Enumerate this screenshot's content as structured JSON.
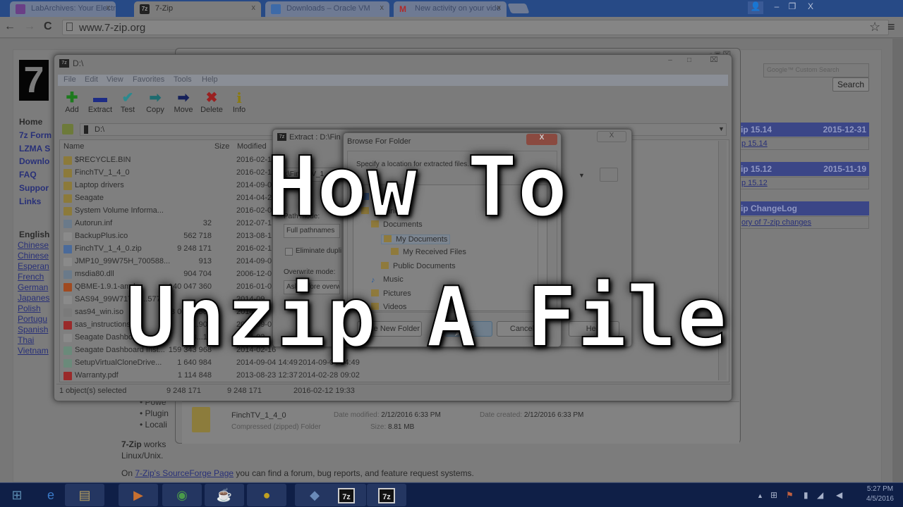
{
  "overlay_title": {
    "line1": "How To",
    "line2": "Unzip A File"
  },
  "browser": {
    "tabs": [
      {
        "label": "LabArchives: Your Electro",
        "icon": "flask-icon",
        "active": false
      },
      {
        "label": "7-Zip",
        "icon": "7zip-icon",
        "active": true
      },
      {
        "label": "Downloads – Oracle VM",
        "icon": "virtualbox-icon",
        "active": false
      },
      {
        "label": "New activity on your vide",
        "icon": "gmail-icon",
        "active": false
      }
    ],
    "url": "www.7-zip.org",
    "nav": {
      "back": "←",
      "forward": "→",
      "reload": "C"
    },
    "star": "☆",
    "menu": "≡",
    "window_controls": {
      "user": "👤",
      "minimize": "–",
      "maximize": "❐",
      "close": "X"
    }
  },
  "website": {
    "logo": "7",
    "nav": [
      "Home",
      "7z Form",
      "LZMA S",
      "Downlo",
      "FAQ",
      "Suppor",
      "Links"
    ],
    "languages_heading": "English",
    "languages": [
      "Chinese",
      "Chinese",
      "Esperan",
      "French",
      "German",
      "Japanes",
      "Polish",
      "Portugu",
      "Spanish",
      "Thai",
      "Vietnam"
    ],
    "search_placeholder": "Google™ Custom Search",
    "search_button": "Search",
    "releases": [
      {
        "title": "zip 15.14",
        "date": "2015-12-31",
        "link": "p 15.14"
      },
      {
        "title": "zip 15.12",
        "date": "2015-11-19",
        "link": "p 15.12"
      },
      {
        "title": "zip ChangeLog",
        "date": "",
        "link": "ory of 7-zip changes"
      }
    ],
    "bullets": [
      "Powe",
      "Plugin",
      "Locali"
    ],
    "works_bold": "7-Zip",
    "works_text": "works",
    "works_line2": "Linux/Unix.",
    "sf_prefix": "On ",
    "sf_link": "7-Zip's SourceForge Page",
    "sf_suffix": " you can find a forum, bug reports, and feature request systems."
  },
  "explorer_details": {
    "name": "FinchTV_1_4_0",
    "type": "Compressed (zipped) Folder",
    "date_modified_label": "Date modified:",
    "date_modified": "2/12/2016 6:33 PM",
    "date_created_label": "Date created:",
    "date_created": "2/12/2016 6:33 PM",
    "size_label": "Size:",
    "size": "8.81 MB"
  },
  "sevenzip": {
    "title": "D:\\",
    "menu": [
      "File",
      "Edit",
      "View",
      "Favorites",
      "Tools",
      "Help"
    ],
    "toolbar": [
      {
        "label": "Add",
        "icon": "plus-icon",
        "glyph": "✚",
        "color": "#1e7a1e"
      },
      {
        "label": "Extract",
        "icon": "minus-icon",
        "glyph": "▬",
        "color": "#1d2c86"
      },
      {
        "label": "Test",
        "icon": "checkmark-icon",
        "glyph": "✔",
        "color": "#2b8a8f"
      },
      {
        "label": "Copy",
        "icon": "copy-arrow-icon",
        "glyph": "➡",
        "color": "#1e6b6f"
      },
      {
        "label": "Move",
        "icon": "move-arrow-icon",
        "glyph": "➡",
        "color": "#15205a"
      },
      {
        "label": "Delete",
        "icon": "delete-x-icon",
        "glyph": "✖",
        "color": "#9a2020"
      },
      {
        "label": "Info",
        "icon": "info-icon",
        "glyph": "i",
        "color": "#8a7a10"
      }
    ],
    "address": "D:\\",
    "columns": {
      "name": "Name",
      "size": "Size",
      "modified": "Modified"
    },
    "files": [
      {
        "name": "$RECYCLE.BIN",
        "size": "",
        "modified": "2016-02-1",
        "extra": "",
        "type": "folder"
      },
      {
        "name": "FinchTV_1_4_0",
        "size": "",
        "modified": "2016-02-1",
        "extra": "",
        "type": "folder"
      },
      {
        "name": "Laptop drivers",
        "size": "",
        "modified": "2014-09-0",
        "extra": "",
        "type": "folder"
      },
      {
        "name": "Seagate",
        "size": "",
        "modified": "2014-04-2",
        "extra": "",
        "type": "folder"
      },
      {
        "name": "System Volume Informa...",
        "size": "",
        "modified": "2016-02-0",
        "extra": "",
        "type": "folder"
      },
      {
        "name": "Autorun.inf",
        "size": "32",
        "modified": "2012-07-1",
        "extra": "",
        "type": "inf"
      },
      {
        "name": "BackupPlus.ico",
        "size": "562 718",
        "modified": "2013-08-1",
        "extra": "",
        "type": "file"
      },
      {
        "name": "FinchTV_1_4_0.zip",
        "size": "9 248 171",
        "modified": "2016-02-1",
        "extra": "",
        "type": "zip"
      },
      {
        "name": "JMP10_99W75H_700588...",
        "size": "913",
        "modified": "2014-09-0",
        "extra": "",
        "type": "file"
      },
      {
        "name": "msdia80.dll",
        "size": "904 704",
        "modified": "2006-12-0",
        "extra": "",
        "type": "dll"
      },
      {
        "name": "QBME-1.9.1-amd...",
        "size": "140 047 360",
        "modified": "2016-01-0",
        "extra": "",
        "type": "box"
      },
      {
        "name": "SAS94_99W71T_7...577...",
        "size": "",
        "modified": "2014-09",
        "extra": "",
        "type": "file"
      },
      {
        "name": "sas94_win.iso",
        "size": "3 003 ...584",
        "modified": "2014-09",
        "extra": "",
        "type": "iso"
      },
      {
        "name": "sas_instructions.p...",
        "size": "1 ...907",
        "modified": "2014-09-0",
        "extra": "",
        "type": "pdf"
      },
      {
        "name": "Seagate Dashboard...",
        "size": "13...15",
        "modified": "2014-02",
        "extra": "",
        "type": "file"
      },
      {
        "name": "Seagate Dashboard Inst...",
        "size": "159 343 968",
        "modified": "2014-02-16",
        "extra": "",
        "type": "exe"
      },
      {
        "name": "SetupVirtualCloneDrive...",
        "size": "1 640 984",
        "modified": "2014-09-04 14:49",
        "extra": "2014-09-04 14:49",
        "type": "exe"
      },
      {
        "name": "Warranty.pdf",
        "size": "1 114 848",
        "modified": "2013-08-23 12:37",
        "extra": "2014-02-28 09:02",
        "type": "pdf"
      }
    ],
    "status": {
      "selected": "1 object(s) selected",
      "size": "9 248 171",
      "packed": "9 248 171",
      "date": "2016-02-12 19:33"
    }
  },
  "extract_dialog": {
    "title": "Extract : D:\\Fin",
    "path_value": "D:\\FinchTV_1_4_",
    "path_mode_label": "Path mode:",
    "path_mode_value": "Full pathnames",
    "eliminate_label": "Eliminate duplicate",
    "overwrite_label": "Overwrite mode:",
    "overwrite_value": "Ask before overwrite",
    "close": "X",
    "help_button": "Help"
  },
  "browse_dialog": {
    "title": "Browse For Folder",
    "close": "X",
    "prompt": "Specify a location for extracted files.",
    "tree": [
      {
        "label": "Desktop",
        "level": 0,
        "icon": "desktop-icon"
      },
      {
        "label": "Libraries",
        "level": 0,
        "icon": "libraries-icon",
        "expanded": true
      },
      {
        "label": "Documents",
        "level": 1,
        "icon": "folder-icon"
      },
      {
        "label": "My Documents",
        "level": 2,
        "icon": "folder-icon",
        "selected": true,
        "expanded": true
      },
      {
        "label": "My Received Files",
        "level": 3,
        "icon": "folder-icon"
      },
      {
        "label": "Public Documents",
        "level": 2,
        "icon": "folder-icon"
      },
      {
        "label": "Music",
        "level": 1,
        "icon": "music-icon"
      },
      {
        "label": "Pictures",
        "level": 1,
        "icon": "folder-icon"
      },
      {
        "label": "Videos",
        "level": 1,
        "icon": "folder-icon"
      }
    ],
    "make_folder_button": "Make New Folder",
    "ok_button": "OK",
    "cancel_button": "Cancel"
  },
  "taskbar": {
    "apps": [
      {
        "name": "start-button",
        "glyph": "⊞",
        "color": "#5a8ab0"
      },
      {
        "name": "internet-explorer",
        "glyph": "e",
        "color": "#3a7ac8"
      },
      {
        "name": "file-explorer",
        "glyph": "▤",
        "color": "#b8a060"
      },
      {
        "name": "media-player",
        "glyph": "▶",
        "color": "#c87030"
      },
      {
        "name": "chrome",
        "glyph": "◉",
        "color": "#4a9a4a"
      },
      {
        "name": "coffee-app",
        "glyph": "☕",
        "color": "#a08a60"
      },
      {
        "name": "vpn-app",
        "glyph": "●",
        "color": "#c0a020"
      },
      {
        "name": "virtualbox",
        "glyph": "◆",
        "color": "#6a8ab8"
      },
      {
        "name": "7zip-1",
        "glyph": "7z",
        "color": "#d0d0d0"
      },
      {
        "name": "7zip-2",
        "glyph": "7z",
        "color": "#d0d0d0"
      }
    ],
    "tray": {
      "arrow": "▲",
      "flag": "⚑",
      "battery": "▮",
      "signal": "◢",
      "volume": "◀"
    },
    "time": "5:27 PM",
    "date": "4/5/2016"
  }
}
